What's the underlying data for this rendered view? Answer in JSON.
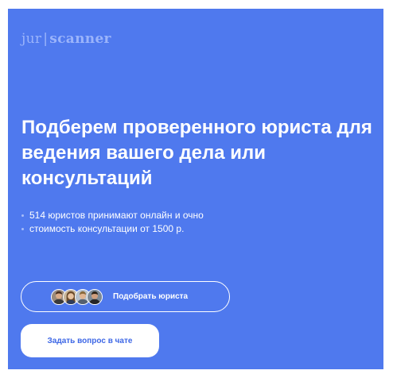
{
  "logo": {
    "left": "jur",
    "separator": "|",
    "right": "scanner"
  },
  "headline": "Подберем проверенного юриста для ведения вашего дела или консультаций",
  "bullets": [
    "514 юристов принимают онлайн и очно",
    "стоимость консультации от 1500 р."
  ],
  "pick_button": {
    "label": "Подобрать юриста",
    "avatars": [
      "lawyer-avatar-1",
      "lawyer-avatar-2",
      "lawyer-avatar-3",
      "lawyer-avatar-4"
    ]
  },
  "ask_button": {
    "label": "Задать вопрос в чате"
  },
  "colors": {
    "background": "#4f79ee",
    "logo": "#9bb4fb",
    "ask_text": "#3d67e6"
  }
}
